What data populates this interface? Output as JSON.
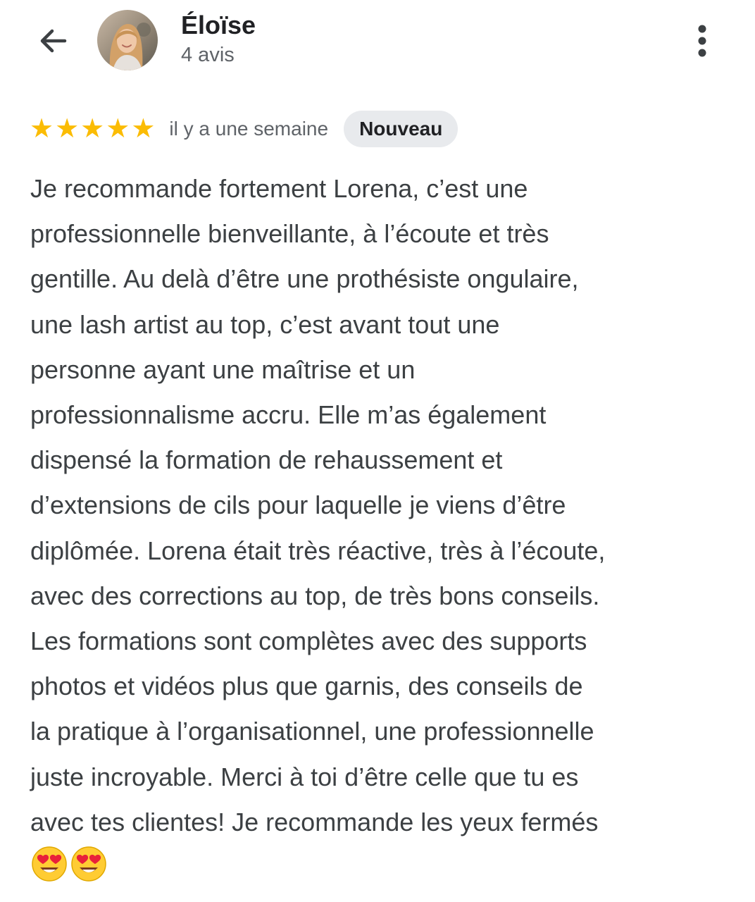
{
  "reviewer": {
    "name": "Éloïse",
    "review_count": "4 avis"
  },
  "review": {
    "rating": 5,
    "rating_max": 5,
    "date": "il y a une semaine",
    "badge": "Nouveau",
    "text": "Je recommande fortement Lorena, c’est une\nprofessionnelle bienveillante, à l’écoute et très\ngentille. Au delà d’être une prothésiste ongulaire,\nune lash artist au top, c’est avant tout une\npersonne ayant une maîtrise et un\nprofessionnalisme accru. Elle m’as également\ndispensé la formation de rehaussement et\nd’extensions de cils pour laquelle je viens d’être\ndiplômée. Lorena était très réactive, très à l’écoute,\navec des corrections au top, de très bons conseils.\nLes formations sont complètes avec des supports\nphotos et vidéos plus que garnis, des conseils de\nla pratique à l’organisationnel, une professionnelle\njuste incroyable. Merci à toi d’être celle que tu es\navec tes clientes! Je recommande les yeux fermés",
    "emojis": [
      "heart-eyes-emoji",
      "heart-eyes-emoji"
    ]
  },
  "icons": {
    "back": "arrow-left-icon",
    "more": "more-vertical-icon",
    "star": "star-icon"
  },
  "colors": {
    "star": "#fbbc04",
    "badge_bg": "#e8eaed",
    "text": "#3c4043",
    "secondary_text": "#5f6368"
  }
}
